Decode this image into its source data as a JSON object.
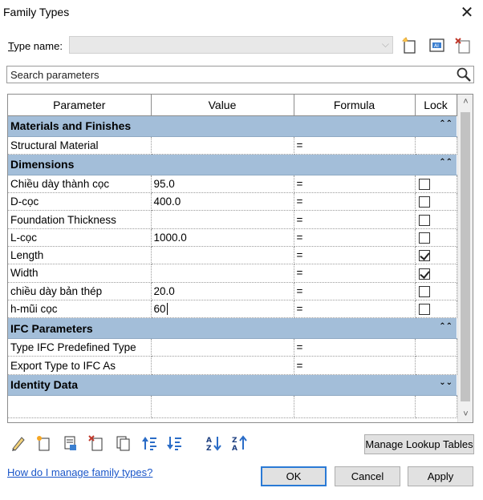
{
  "window": {
    "title": "Family Types",
    "close_glyph": "✕"
  },
  "type_name": {
    "label": "Type name:",
    "value": "",
    "dropdown_glyph": "⌵"
  },
  "toolbar_top": [
    "new-type-icon",
    "rename-type-icon",
    "delete-type-icon"
  ],
  "search": {
    "placeholder": "Search parameters"
  },
  "grid": {
    "columns": {
      "parameter": "Parameter",
      "value": "Value",
      "formula": "Formula",
      "lock": "Lock"
    },
    "collapse_up_glyph": "⌃⌃",
    "collapse_down_glyph": "⌄⌄",
    "groups": [
      {
        "name": "Materials and Finishes",
        "expanded": true,
        "rows": [
          {
            "param": "Structural Material",
            "value": "",
            "formula": "=",
            "lock": null
          }
        ]
      },
      {
        "name": "Dimensions",
        "expanded": true,
        "rows": [
          {
            "param": "Chiều dày thành cọc",
            "value": "95.0",
            "formula": "=",
            "lock": false
          },
          {
            "param": "D-cọc",
            "value": "400.0",
            "formula": "=",
            "lock": false
          },
          {
            "param": "Foundation Thickness",
            "value": "",
            "formula": "=",
            "lock": false
          },
          {
            "param": "L-cọc",
            "value": "1000.0",
            "formula": "=",
            "lock": false
          },
          {
            "param": "Length",
            "value": "",
            "formula": "=",
            "lock": true
          },
          {
            "param": "Width",
            "value": "",
            "formula": "=",
            "lock": true
          },
          {
            "param": "chiều dày bản thép",
            "value": "20.0",
            "formula": "=",
            "lock": false
          },
          {
            "param": "h-mũi cọc",
            "value": "60",
            "formula": "=",
            "lock": false
          }
        ]
      },
      {
        "name": "IFC Parameters",
        "expanded": true,
        "rows": [
          {
            "param": "Type IFC Predefined Type",
            "value": "",
            "formula": "=",
            "lock": null
          },
          {
            "param": "Export Type to IFC As",
            "value": "",
            "formula": "=",
            "lock": null
          }
        ]
      },
      {
        "name": "Identity Data",
        "expanded": false,
        "rows": []
      }
    ]
  },
  "toolbar_bottom": [
    "edit-parameter-icon",
    "new-parameter-icon",
    "delete-parameter-icon",
    "move-up-icon",
    "move-down-icon",
    "sort-ascending-icon",
    "sort-descending-icon",
    "copy-icon",
    "manage-icon"
  ],
  "buttons": {
    "manage_lookup": "Manage Lookup Tables",
    "ok": "OK",
    "cancel": "Cancel",
    "apply": "Apply"
  },
  "help_link": "How do I manage family types?",
  "colors": {
    "group_header": "#a3bed9",
    "link": "#1a56c9",
    "ok_border": "#2a7ad5"
  }
}
